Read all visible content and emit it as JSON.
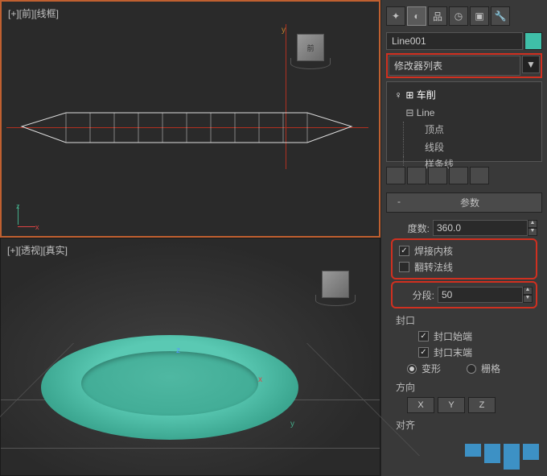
{
  "viewports": {
    "front": {
      "label": "[+][前][线框]",
      "axis_y": "y",
      "axis_z": "z",
      "axis_x": "x",
      "cube_face": "前"
    },
    "persp": {
      "label": "[+][透视][真实]",
      "axis_x": "x",
      "axis_y": "y",
      "axis_z": "z"
    }
  },
  "panel": {
    "object_name": "Line001",
    "modifier_list_label": "修改器列表",
    "stack": {
      "lathe": "车削",
      "line": "Line",
      "vertex": "顶点",
      "segment": "线段",
      "spline": "样条线"
    },
    "rollout_params": "参数",
    "degrees_label": "度数:",
    "degrees_value": "360.0",
    "weld_core": "焊接内核",
    "flip_normals": "翻转法线",
    "segments_label": "分段:",
    "segments_value": "50",
    "capping_label": "封口",
    "cap_start": "封口始端",
    "cap_end": "封口末端",
    "morph": "变形",
    "grid": "栅格",
    "direction_label": "方向",
    "x": "X",
    "y": "Y",
    "z": "Z",
    "align_label": "对齐"
  }
}
